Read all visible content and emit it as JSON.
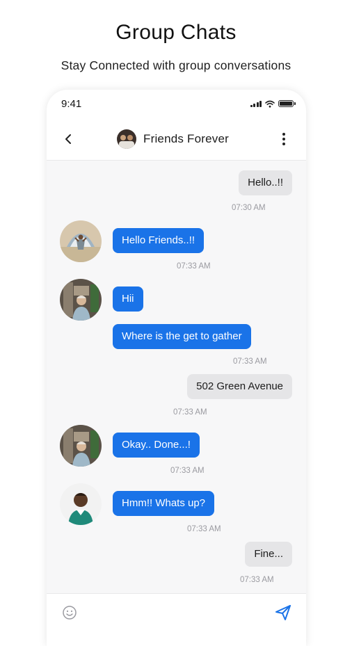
{
  "promo": {
    "title": "Group Chats",
    "subtitle": "Stay Connected with group conversations"
  },
  "status_bar": {
    "time": "9:41",
    "icons": [
      "signal-icon",
      "wifi-icon",
      "battery-icon"
    ]
  },
  "header": {
    "back_icon": "chevron-left-icon",
    "group_name": "Friends Forever",
    "more_icon": "more-vertical-icon"
  },
  "messages": [
    {
      "direction": "outgoing",
      "text": "Hello..!!",
      "time": "07:30 AM"
    },
    {
      "direction": "incoming",
      "sender_avatar": "avatar-1",
      "text": "Hello Friends..!!",
      "time": "07:33 AM"
    },
    {
      "direction": "incoming",
      "sender_avatar": "avatar-2",
      "text": "Hii",
      "time": ""
    },
    {
      "direction": "incoming",
      "sender_avatar": "",
      "text": "Where is the get to gather",
      "time": "07:33 AM"
    },
    {
      "direction": "outgoing",
      "text": "502 Green Avenue",
      "time": "07:33 AM"
    },
    {
      "direction": "incoming",
      "sender_avatar": "avatar-2",
      "text": "Okay.. Done...!",
      "time": "07:33 AM"
    },
    {
      "direction": "incoming",
      "sender_avatar": "avatar-3",
      "text": "Hmm!! Whats up?",
      "time": "07:33 AM"
    },
    {
      "direction": "outgoing",
      "text": "Fine...",
      "time": "07:33 AM"
    }
  ],
  "composer": {
    "emoji_icon": "smiley-icon",
    "placeholder": "",
    "value": "",
    "send_icon": "send-icon"
  },
  "colors": {
    "accent": "#1a73e8",
    "outgoing_bubble": "#e5e5e7",
    "timestamp": "#9a9aa0",
    "chat_background": "#f7f7f8"
  }
}
